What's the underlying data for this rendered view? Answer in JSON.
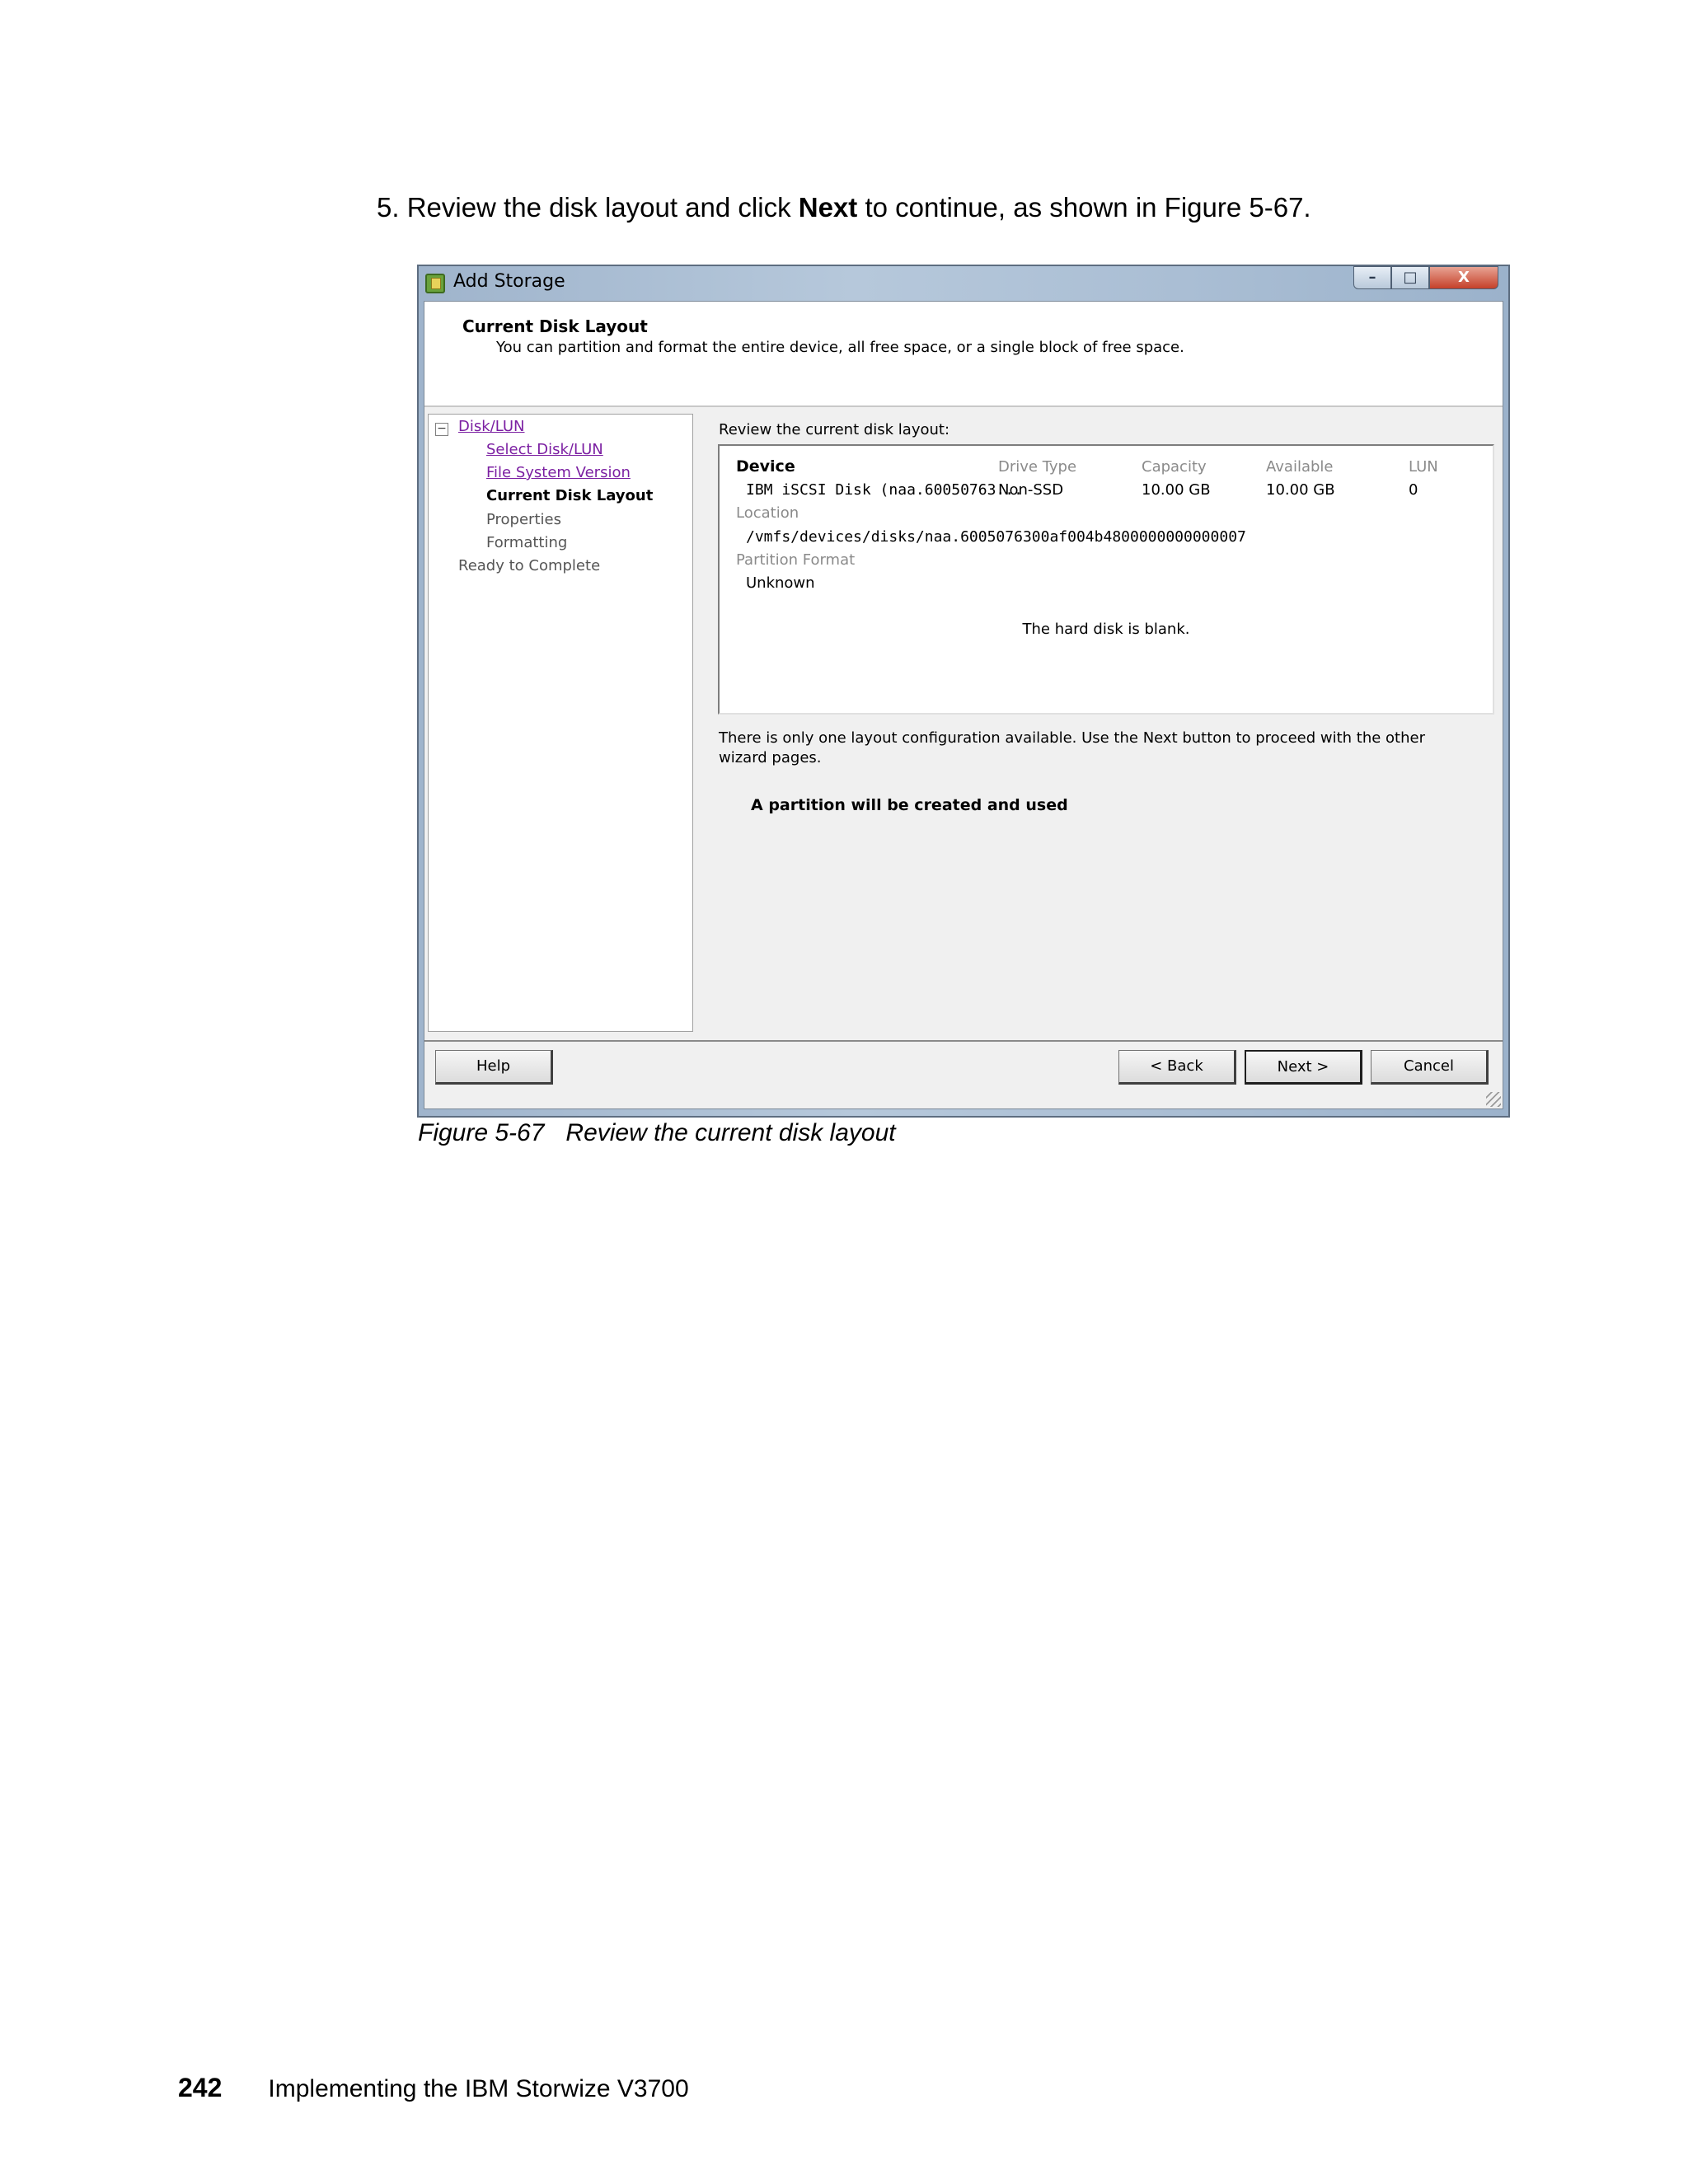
{
  "document": {
    "step_prefix": "5.  Review the disk layout and click ",
    "step_bold": "Next",
    "step_suffix": " to continue, as shown in Figure 5-67.",
    "figure_label": "Figure 5-67",
    "figure_caption": "Review the current disk layout",
    "page_number": "242",
    "book_title": "Implementing the IBM Storwize V3700"
  },
  "window": {
    "title": "Add Storage",
    "controls": {
      "minimize": "–",
      "maximize": "□",
      "close": "X"
    },
    "icon": "storage-wizard-icon"
  },
  "header": {
    "title": "Current Disk Layout",
    "subtitle": "You can partition and format the entire device, all free space, or a single block of free space."
  },
  "nav": {
    "toggle": "−",
    "items": [
      {
        "label": "Disk/LUN",
        "state": "link"
      },
      {
        "label": "Select Disk/LUN",
        "state": "link"
      },
      {
        "label": "File System Version",
        "state": "link"
      },
      {
        "label": "Current Disk Layout",
        "state": "current"
      },
      {
        "label": "Properties",
        "state": "pending"
      },
      {
        "label": "Formatting",
        "state": "pending"
      },
      {
        "label": "Ready to Complete",
        "state": "pending"
      }
    ]
  },
  "content": {
    "label": "Review the current disk layout:",
    "columns": [
      "Device",
      "Drive Type",
      "Capacity",
      "Available",
      "LUN"
    ],
    "row": [
      "IBM iSCSI Disk (naa.60050763...",
      "Non-SSD",
      "10.00 GB",
      "10.00 GB",
      "0"
    ],
    "location_label": "Location",
    "location_value": "/vmfs/devices/disks/naa.6005076300af004b4800000000000007",
    "partition_format_label": "Partition Format",
    "partition_format_value": "Unknown",
    "blank_message": "The hard disk is blank.",
    "info": "There is only one layout configuration available. Use the Next button to proceed with the other wizard pages.",
    "partition_note": "A partition will be created and used"
  },
  "buttons": {
    "help": "Help",
    "back": "< Back",
    "next": "Next >",
    "cancel": "Cancel"
  }
}
